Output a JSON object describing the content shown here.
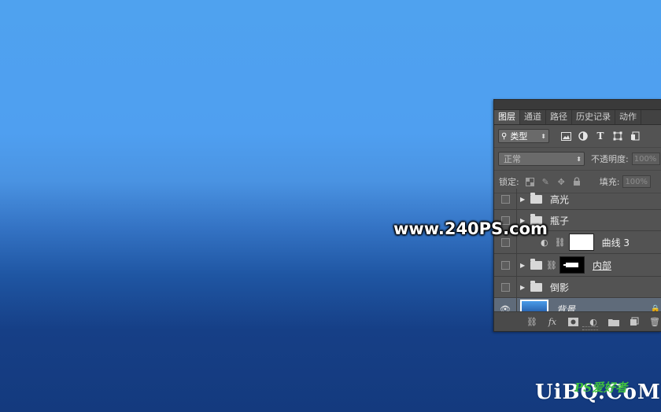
{
  "watermark": {
    "text": "www.240PS.com"
  },
  "panel": {
    "tabs": [
      {
        "label": "图层",
        "active": true
      },
      {
        "label": "通道",
        "active": false
      },
      {
        "label": "路径",
        "active": false
      },
      {
        "label": "历史记录",
        "active": false
      },
      {
        "label": "动作",
        "active": false
      }
    ],
    "filter": {
      "label": "类型"
    },
    "blend": {
      "mode": "正常",
      "opacity_label": "不透明度:",
      "opacity_value": "100%"
    },
    "lock": {
      "label": "锁定:",
      "fill_label": "填充:",
      "fill_value": "100%"
    },
    "layers": [
      {
        "name": "高光",
        "type": "group",
        "visible": false
      },
      {
        "name": "瓶子",
        "type": "group",
        "visible": false
      },
      {
        "name": "曲线 3",
        "type": "adjustment",
        "visible": false
      },
      {
        "name": "内部",
        "type": "group-masked",
        "visible": false
      },
      {
        "name": "倒影",
        "type": "group",
        "visible": false
      },
      {
        "name": "背景",
        "type": "background",
        "visible": true,
        "selected": true
      }
    ]
  },
  "branding": {
    "uibq_prefix": "UiBQ",
    "uibq_suffix": ".CoM",
    "ps_logo": "PS爱好者"
  },
  "colors": {
    "panel_bg": "#535353",
    "selected_row": "#5f6b7a",
    "background_top": "#4fa2ef",
    "background_bottom": "#143a7e"
  }
}
